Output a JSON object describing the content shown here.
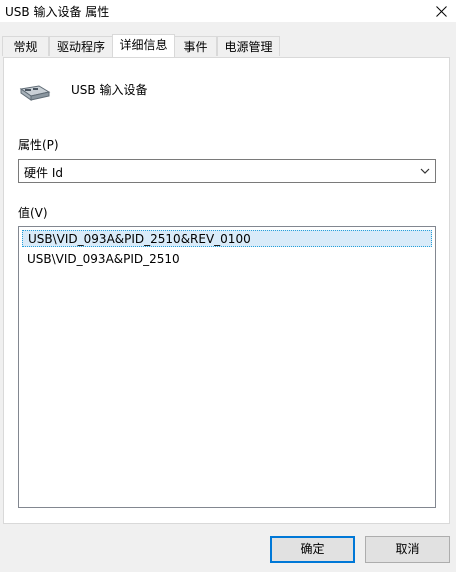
{
  "window": {
    "title": "USB 输入设备 属性"
  },
  "tabs": [
    {
      "label": "常规"
    },
    {
      "label": "驱动程序"
    },
    {
      "label": "详细信息"
    },
    {
      "label": "事件"
    },
    {
      "label": "电源管理"
    }
  ],
  "active_tab": "详细信息",
  "device": {
    "name": "USB 输入设备",
    "icon": "usb-device-icon"
  },
  "property": {
    "label": "属性(P)",
    "selected": "硬件 Id"
  },
  "value": {
    "label": "值(V)",
    "items": [
      {
        "text": "USB\\VID_093A&PID_2510&REV_0100"
      },
      {
        "text": "USB\\VID_093A&PID_2510"
      }
    ]
  },
  "buttons": {
    "ok": "确定",
    "cancel": "取消"
  },
  "colors": {
    "selection": "#d9ebf9",
    "accent": "#0078d7"
  }
}
